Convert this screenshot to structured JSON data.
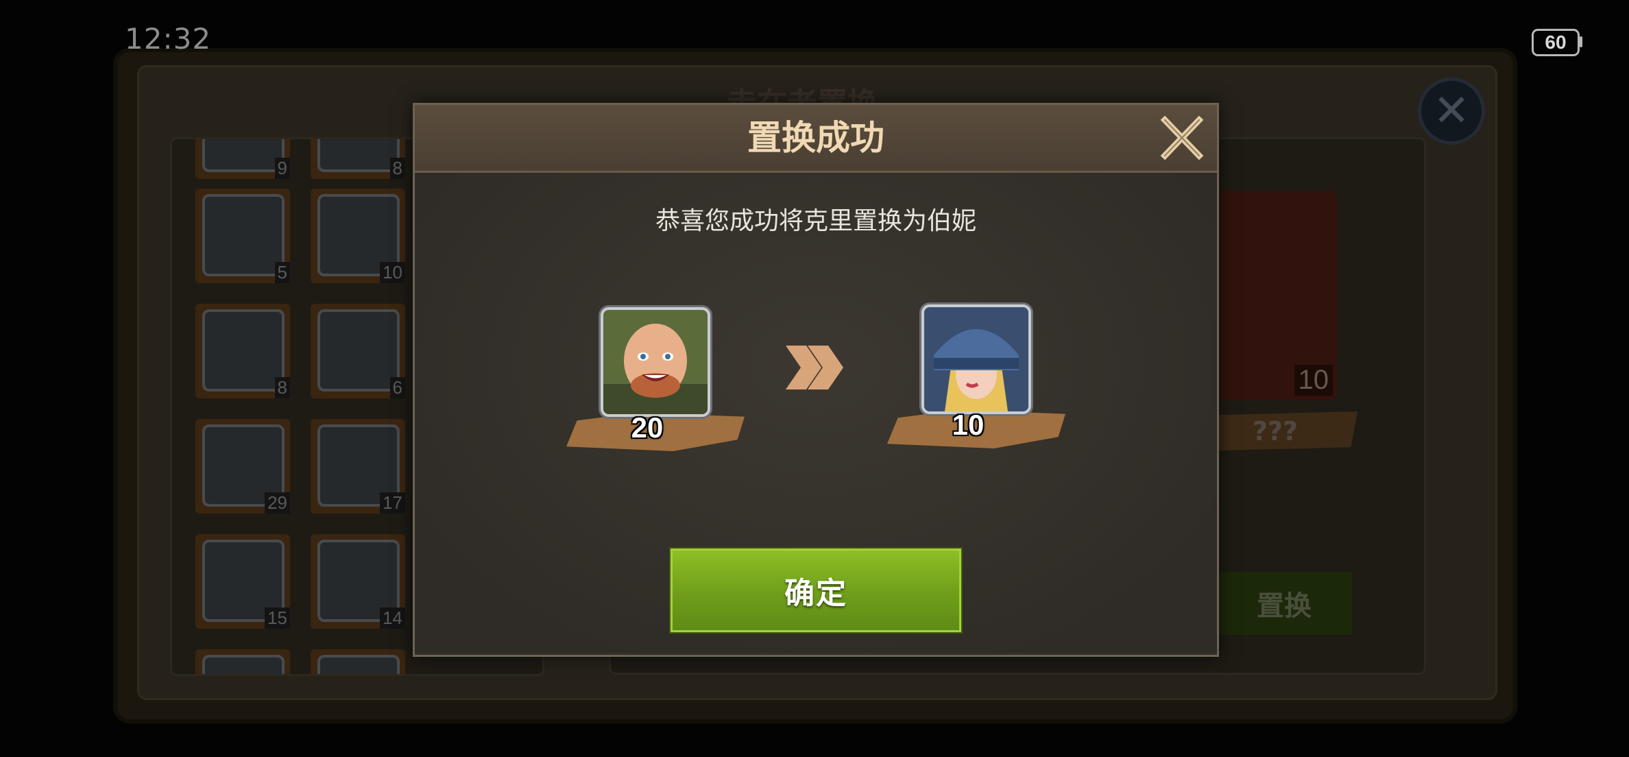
{
  "status_bar": {
    "time": "12:32",
    "battery": "60"
  },
  "background": {
    "title": "走在老置换",
    "list_items": [
      {
        "count": "5",
        "icon": "soldier-portrait"
      },
      {
        "count": "10",
        "icon": "scholar-portrait"
      },
      {
        "count": "8",
        "icon": "soldier-portrait"
      },
      {
        "count": "6",
        "icon": "officer-portrait"
      },
      {
        "count": "29",
        "icon": "commander-portrait"
      },
      {
        "count": "17",
        "icon": "masked-portrait"
      },
      {
        "count": "15",
        "icon": "woman-portrait"
      },
      {
        "count": "14",
        "icon": "woman-portrait"
      }
    ],
    "partial_counts_top": [
      "9",
      "8"
    ],
    "selected_count": "10",
    "unknown_label": "???",
    "exchange_button": "置换"
  },
  "dialog": {
    "title": "置换成功",
    "message": "恭喜您成功将克里置换为伯妮",
    "from": {
      "name": "克里",
      "count": "20"
    },
    "to": {
      "name": "伯妮",
      "count": "10"
    },
    "confirm_label": "确定"
  },
  "colors": {
    "title_text": "#f0d9b3",
    "confirm_green": "#7aab1f",
    "ribbon": "#a07040"
  }
}
